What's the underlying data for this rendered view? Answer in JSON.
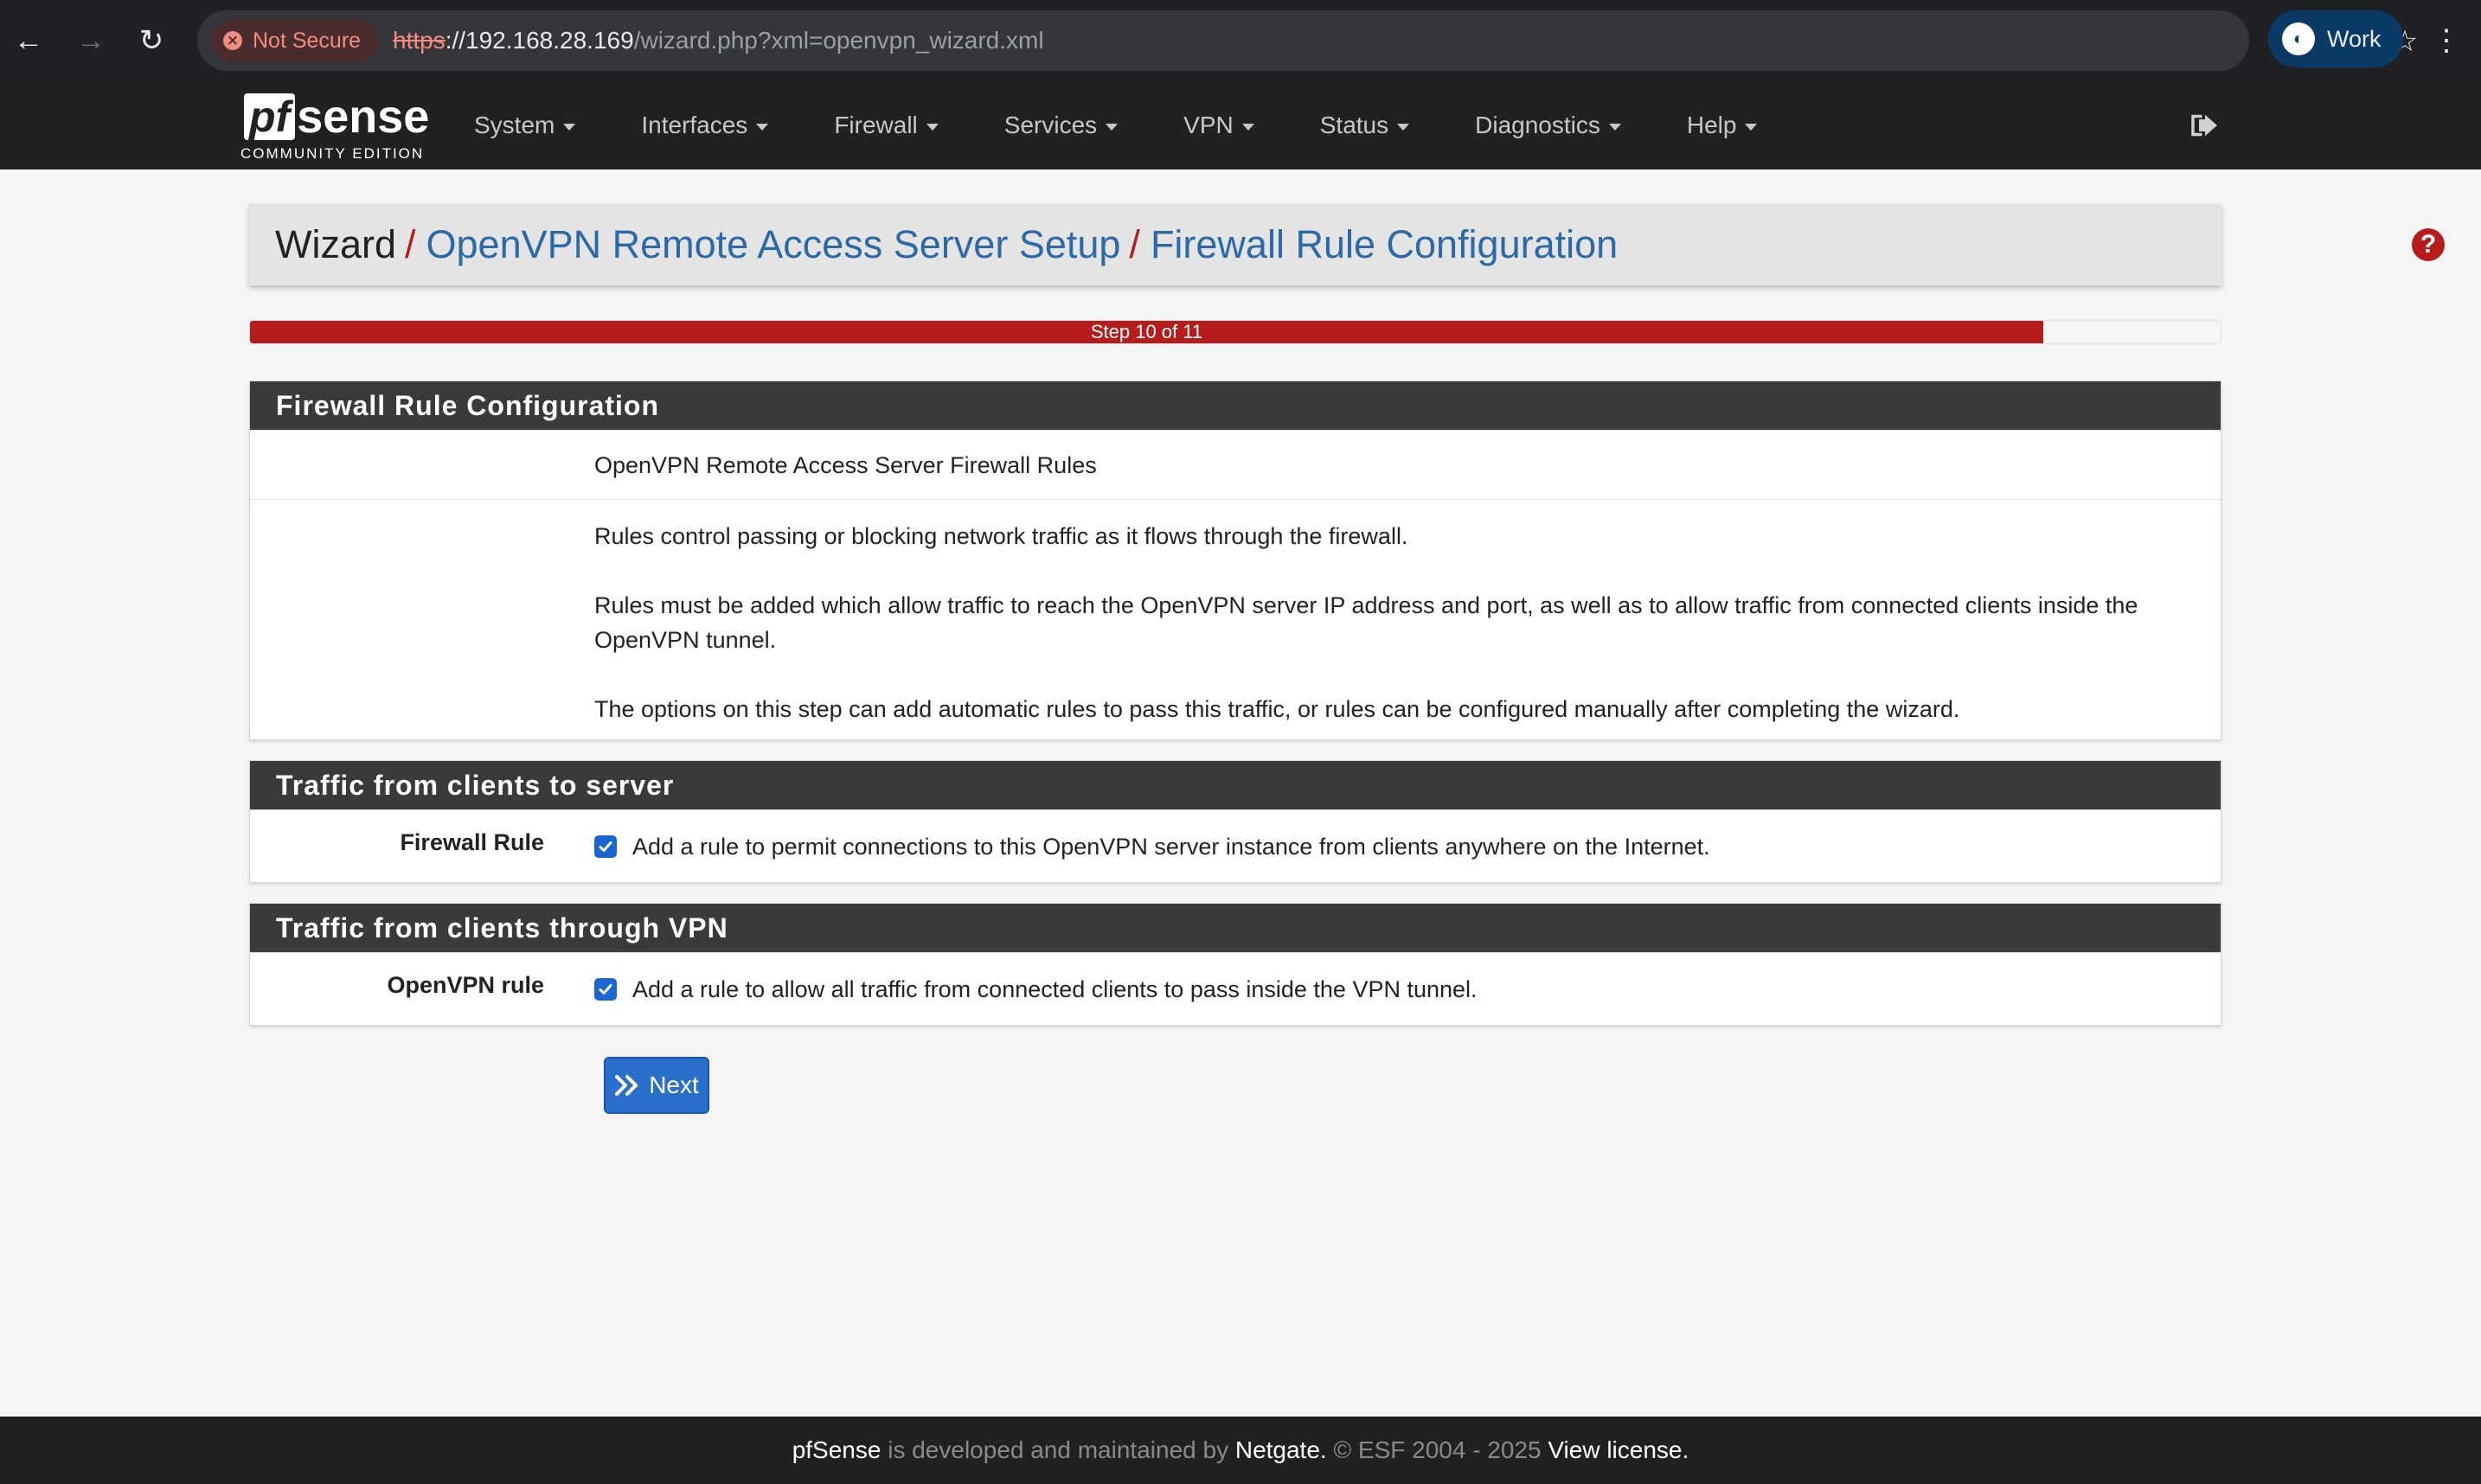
{
  "browser": {
    "security_label": "Not Secure",
    "url_scheme": "https",
    "url_host": "://192.168.28.169",
    "url_path": "/wizard.php?xml=openvpn_wizard.xml",
    "profile_label": "Work"
  },
  "navbar": {
    "logo_pf": "pf",
    "logo_sense": "sense",
    "logo_edition": "COMMUNITY EDITION",
    "menu": [
      "System",
      "Interfaces",
      "Firewall",
      "Services",
      "VPN",
      "Status",
      "Diagnostics",
      "Help"
    ]
  },
  "breadcrumb": {
    "root": "Wizard",
    "sep": "/",
    "level1": "OpenVPN Remote Access Server Setup",
    "level2": "Firewall Rule Configuration"
  },
  "progress": {
    "label": "Step 10 of 11",
    "fraction": 0.91
  },
  "sections": {
    "config": {
      "heading": "Firewall Rule Configuration",
      "subtitle": "OpenVPN Remote Access Server Firewall Rules",
      "para1": "Rules control passing or blocking network traffic as it flows through the firewall.",
      "para2": "Rules must be added which allow traffic to reach the OpenVPN server IP address and port, as well as to allow traffic from connected clients inside the OpenVPN tunnel.",
      "para3": "The options on this step can add automatic rules to pass this traffic, or rules can be configured manually after completing the wizard."
    },
    "server": {
      "heading": "Traffic from clients to server",
      "label": "Firewall Rule",
      "checkbox_text": "Add a rule to permit connections to this OpenVPN server instance from clients anywhere on the Internet.",
      "checked": true
    },
    "vpn": {
      "heading": "Traffic from clients through VPN",
      "label": "OpenVPN rule",
      "checkbox_text": "Add a rule to allow all traffic from connected clients to pass inside the VPN tunnel.",
      "checked": true
    }
  },
  "next_button": "Next",
  "footer": {
    "brand": "pfSense",
    "text1": " is developed and maintained by ",
    "company": "Netgate.",
    "text2": " © ESF 2004 - 2025 ",
    "license": "View license."
  },
  "colors": {
    "accent_red": "#b71c1c",
    "link_blue": "#2b6aa6",
    "button_blue": "#2a6fc9",
    "header_dark": "#212121"
  }
}
